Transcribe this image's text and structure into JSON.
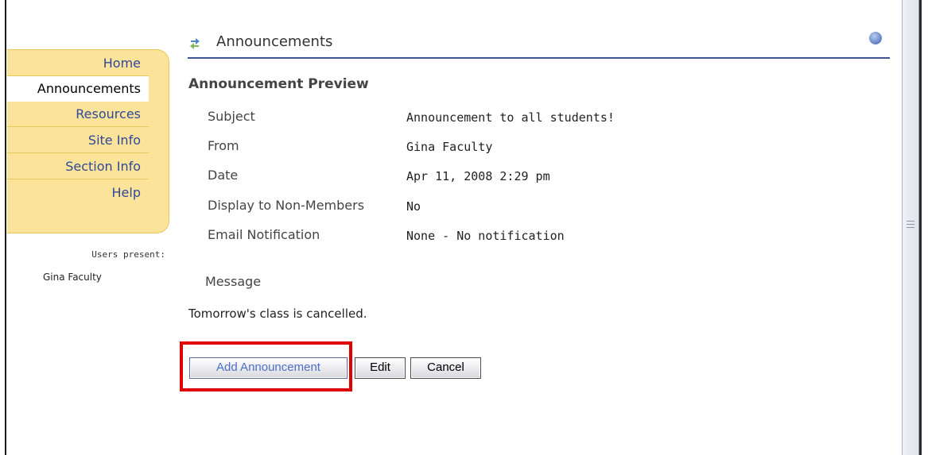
{
  "header": {
    "title": "Announcements",
    "help_icon": "help-icon",
    "refresh_icon": "refresh-icon"
  },
  "sidebar": {
    "items": [
      {
        "label": "Home",
        "active": false
      },
      {
        "label": "Announcements",
        "active": true
      },
      {
        "label": "Resources",
        "active": false
      },
      {
        "label": "Site Info",
        "active": false
      },
      {
        "label": "Section Info",
        "active": false
      },
      {
        "label": "Help",
        "active": false
      }
    ],
    "users_present_label": "Users present:",
    "users": [
      "Gina Faculty"
    ]
  },
  "preview": {
    "title": "Announcement Preview",
    "rows": [
      {
        "label": "Subject",
        "value": "Announcement to all students!"
      },
      {
        "label": "From",
        "value": "Gina Faculty"
      },
      {
        "label": "Date",
        "value": "Apr 11, 2008 2:29 pm"
      },
      {
        "label": "Display to Non-Members",
        "value": "No"
      },
      {
        "label": "Email Notification",
        "value": "None - No notification"
      }
    ],
    "message_label": "Message",
    "message": "Tomorrow's class is cancelled."
  },
  "buttons": {
    "add": "Add Announcement",
    "edit": "Edit",
    "cancel": "Cancel"
  },
  "colors": {
    "accent": "#3f5593",
    "nav_bg": "#fbe49a",
    "highlight": "#e00000"
  }
}
